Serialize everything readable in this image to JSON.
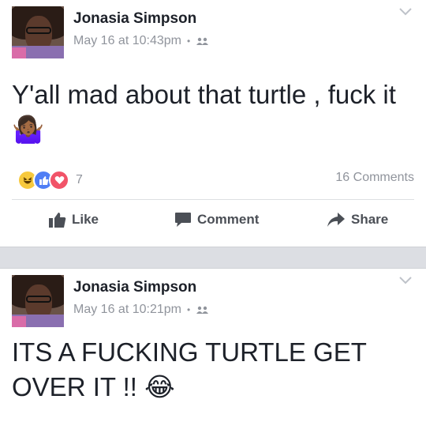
{
  "colors": {
    "text": "#1d2129",
    "meta": "#90949c",
    "action": "#4b4f56",
    "separator": "#dcdee3",
    "like_blue": "#4f7ef5",
    "love_red": "#f15368",
    "haha_yellow": "#f7c93d"
  },
  "posts": [
    {
      "author": "Jonasia Simpson",
      "time": "May 16 at 10:43pm",
      "audience_icon": "friends-icon",
      "text": "Y'all mad about that turtle , fuck it 🤷🏾‍♀️",
      "reactions": [
        "haha",
        "like",
        "love"
      ],
      "reaction_count": "7",
      "comments": "16 Comments",
      "actions": {
        "like": "Like",
        "comment": "Comment",
        "share": "Share"
      }
    },
    {
      "author": "Jonasia Simpson",
      "time": "May 16 at 10:21pm",
      "audience_icon": "friends-icon",
      "text": "ITS A FUCKING TURTLE GET OVER IT !! 😂"
    }
  ]
}
